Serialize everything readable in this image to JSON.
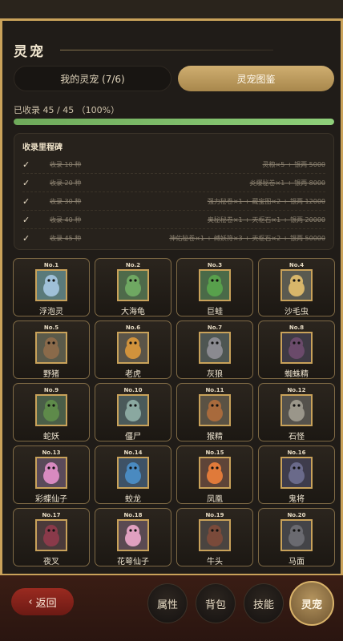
{
  "page": {
    "title": "灵宠"
  },
  "tabs": [
    {
      "label": "我的灵宠 (7/6)",
      "active": false
    },
    {
      "label": "灵宠图鉴",
      "active": true
    }
  ],
  "collection": {
    "label": "已收录 45 / 45 （100%）",
    "progress": 1.0
  },
  "milestones": {
    "title": "收录里程碑",
    "items": [
      {
        "check": "✓",
        "requirement": "收录 10 种",
        "reward": "灵粮×5 + 银两 5000"
      },
      {
        "check": "✓",
        "requirement": "收录 20 种",
        "reward": "炎爆秘卷×1 + 银两 8000"
      },
      {
        "check": "✓",
        "requirement": "收录 30 种",
        "reward": "强力秘卷×1 + 藏宝图×2 + 银两 12000"
      },
      {
        "check": "✓",
        "requirement": "收录 40 种",
        "reward": "奥秘秘卷×1 + 天枢石×1 + 银两 20000"
      },
      {
        "check": "✓",
        "requirement": "收录 45 种",
        "reward": "神佑秘卷×1 + 缚妖符×3 + 天枢石×2 + 银两 50000"
      }
    ]
  },
  "pets": [
    {
      "no": "No.1",
      "name": "浮泡灵",
      "bg": "#5a7a7a",
      "body": "#9fc0d8"
    },
    {
      "no": "No.2",
      "name": "大海龟",
      "bg": "#4e6a4a",
      "body": "#6fa862"
    },
    {
      "no": "No.3",
      "name": "巨蛙",
      "bg": "#4a6a48",
      "body": "#58a04c"
    },
    {
      "no": "No.4",
      "name": "沙毛虫",
      "bg": "#5a5a50",
      "body": "#d8b66a"
    },
    {
      "no": "No.5",
      "name": "野猪",
      "bg": "#5a5a4a",
      "body": "#8a6a4a"
    },
    {
      "no": "No.6",
      "name": "老虎",
      "bg": "#5a5448",
      "body": "#d0923c"
    },
    {
      "no": "No.7",
      "name": "灰狼",
      "bg": "#4e5652",
      "body": "#8a8a90"
    },
    {
      "no": "No.8",
      "name": "蜘蛛精",
      "bg": "#3e3a44",
      "body": "#6a4a6a"
    },
    {
      "no": "No.9",
      "name": "蛇妖",
      "bg": "#4a5e48",
      "body": "#5e8a4a"
    },
    {
      "no": "No.10",
      "name": "僵尸",
      "bg": "#4a5a5a",
      "body": "#8aa8a0"
    },
    {
      "no": "No.11",
      "name": "猴精",
      "bg": "#5a5244",
      "body": "#a86a3c"
    },
    {
      "no": "No.12",
      "name": "石怪",
      "bg": "#55524c",
      "body": "#9a968a"
    },
    {
      "no": "No.13",
      "name": "彩蝶仙子",
      "bg": "#5a4a5a",
      "body": "#d88ac0"
    },
    {
      "no": "No.14",
      "name": "蛟龙",
      "bg": "#3e5266",
      "body": "#4a8ac0"
    },
    {
      "no": "No.15",
      "name": "凤凰",
      "bg": "#5e4438",
      "body": "#e07a3a"
    },
    {
      "no": "No.16",
      "name": "鬼将",
      "bg": "#3e3c4c",
      "body": "#6a6a8a"
    },
    {
      "no": "No.17",
      "name": "夜叉",
      "bg": "#4a3a3a",
      "body": "#8a3a4a"
    },
    {
      "no": "No.18",
      "name": "花萼仙子",
      "bg": "#5a4a52",
      "body": "#e0a0c0"
    },
    {
      "no": "No.19",
      "name": "牛头",
      "bg": "#4a4440",
      "body": "#7a4a3a"
    },
    {
      "no": "No.20",
      "name": "马面",
      "bg": "#444448",
      "body": "#6a6a70"
    }
  ],
  "back_button": {
    "icon": "chevron-left-icon",
    "label": "返回"
  },
  "nav": [
    {
      "label": "属性",
      "active": false
    },
    {
      "label": "背包",
      "active": false
    },
    {
      "label": "技能",
      "active": false
    },
    {
      "label": "灵宠",
      "active": true
    }
  ]
}
